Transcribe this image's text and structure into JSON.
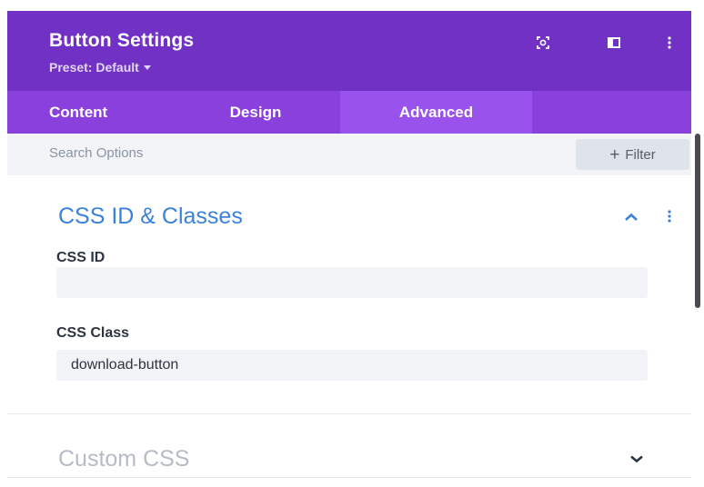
{
  "header": {
    "title": "Button Settings",
    "preset": "Preset: Default",
    "icons": [
      "fullscreen-icon",
      "split-view-icon",
      "more-options-icon"
    ]
  },
  "tabs": [
    {
      "label": "Content",
      "active": false
    },
    {
      "label": "Design",
      "active": false
    },
    {
      "label": "Advanced",
      "active": true
    }
  ],
  "search": {
    "placeholder": "Search Options",
    "filter_label": "Filter"
  },
  "sections": {
    "css_id_classes": {
      "title": "CSS ID & Classes",
      "expanded": true,
      "fields": [
        {
          "label": "CSS ID",
          "value": ""
        },
        {
          "label": "CSS Class",
          "value": "download-button"
        }
      ]
    },
    "custom_css": {
      "title": "Custom CSS",
      "expanded": false
    }
  },
  "colors": {
    "header_bg": "#7031c4",
    "tabs_bg": "#8a40dc",
    "active_tab_bg": "#9a52ec",
    "accent_blue": "#3b82dc"
  }
}
